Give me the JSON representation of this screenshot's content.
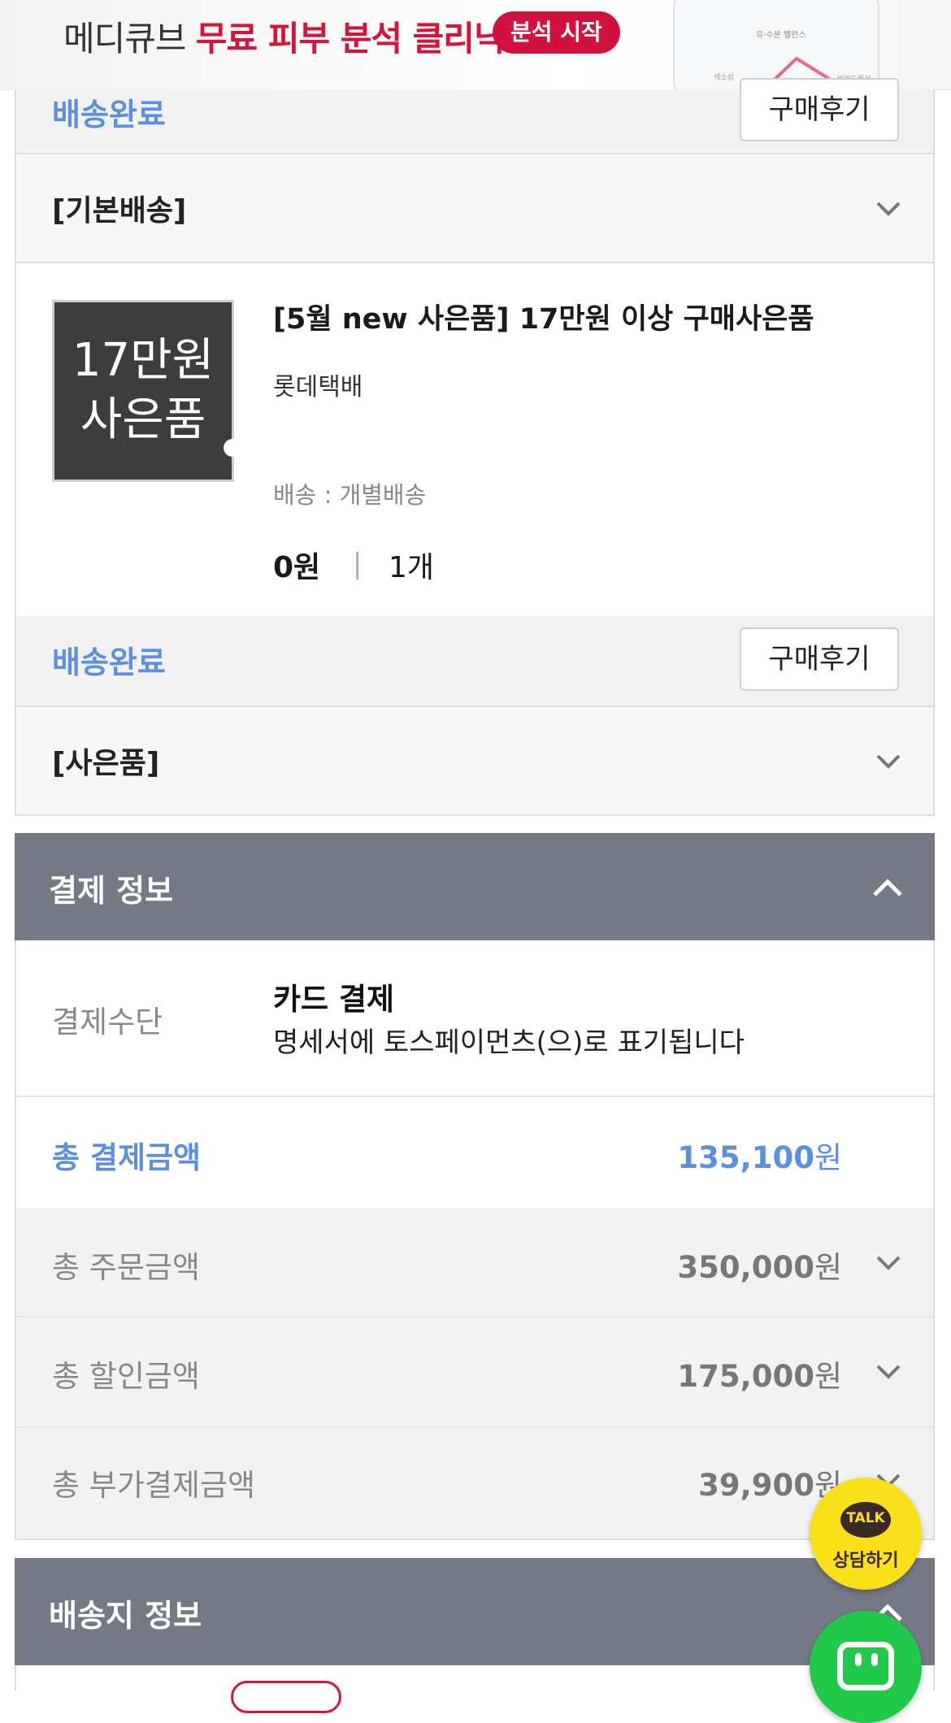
{
  "banner": {
    "brand": "메디큐브",
    "headline": "무료 피부 분석 클리닉",
    "cta": "분석 시작",
    "preview_caption": "유·수분 밸런스",
    "preview_left": "색소성",
    "preview_right": "비여드름성"
  },
  "order_item_prev": {
    "status": "배송완료",
    "review_button": "구매후기",
    "shipping_group": "[기본배송]"
  },
  "order_item": {
    "thumb_line1": "17만원",
    "thumb_line2": "사은품",
    "name": "[5월 new 사은품] 17만원 이상 구매사은품",
    "courier": "롯데택배",
    "shipping": "배송 : 개별배송",
    "price": "0원",
    "separator": "|",
    "quantity": "1개",
    "status": "배송완료",
    "review_button": "구매후기",
    "group": "[사은품]"
  },
  "payment": {
    "title": "결제 정보",
    "method_label": "결제수단",
    "method_value": "카드 결제",
    "method_note": "명세서에 토스페이먼츠(으)로 표기됩니다",
    "total_label": "총 결제금액",
    "total_value": "135,100",
    "currency": "원",
    "order_label": "총 주문금액",
    "order_value": "350,000",
    "discount_label": "총 할인금액",
    "discount_value": "175,000",
    "extra_label": "총 부가결제금액",
    "extra_value": "39,900"
  },
  "shipping_section": {
    "title": "배송지 정보"
  },
  "floating": {
    "kakao_talk": "TALK",
    "kakao_label": "상담하기"
  },
  "colors": {
    "accent_blue": "#5b8fe0",
    "section_header": "#757985",
    "brand_red": "#d4143a",
    "kakao_yellow": "#f9e01b",
    "green": "#20c94a"
  }
}
